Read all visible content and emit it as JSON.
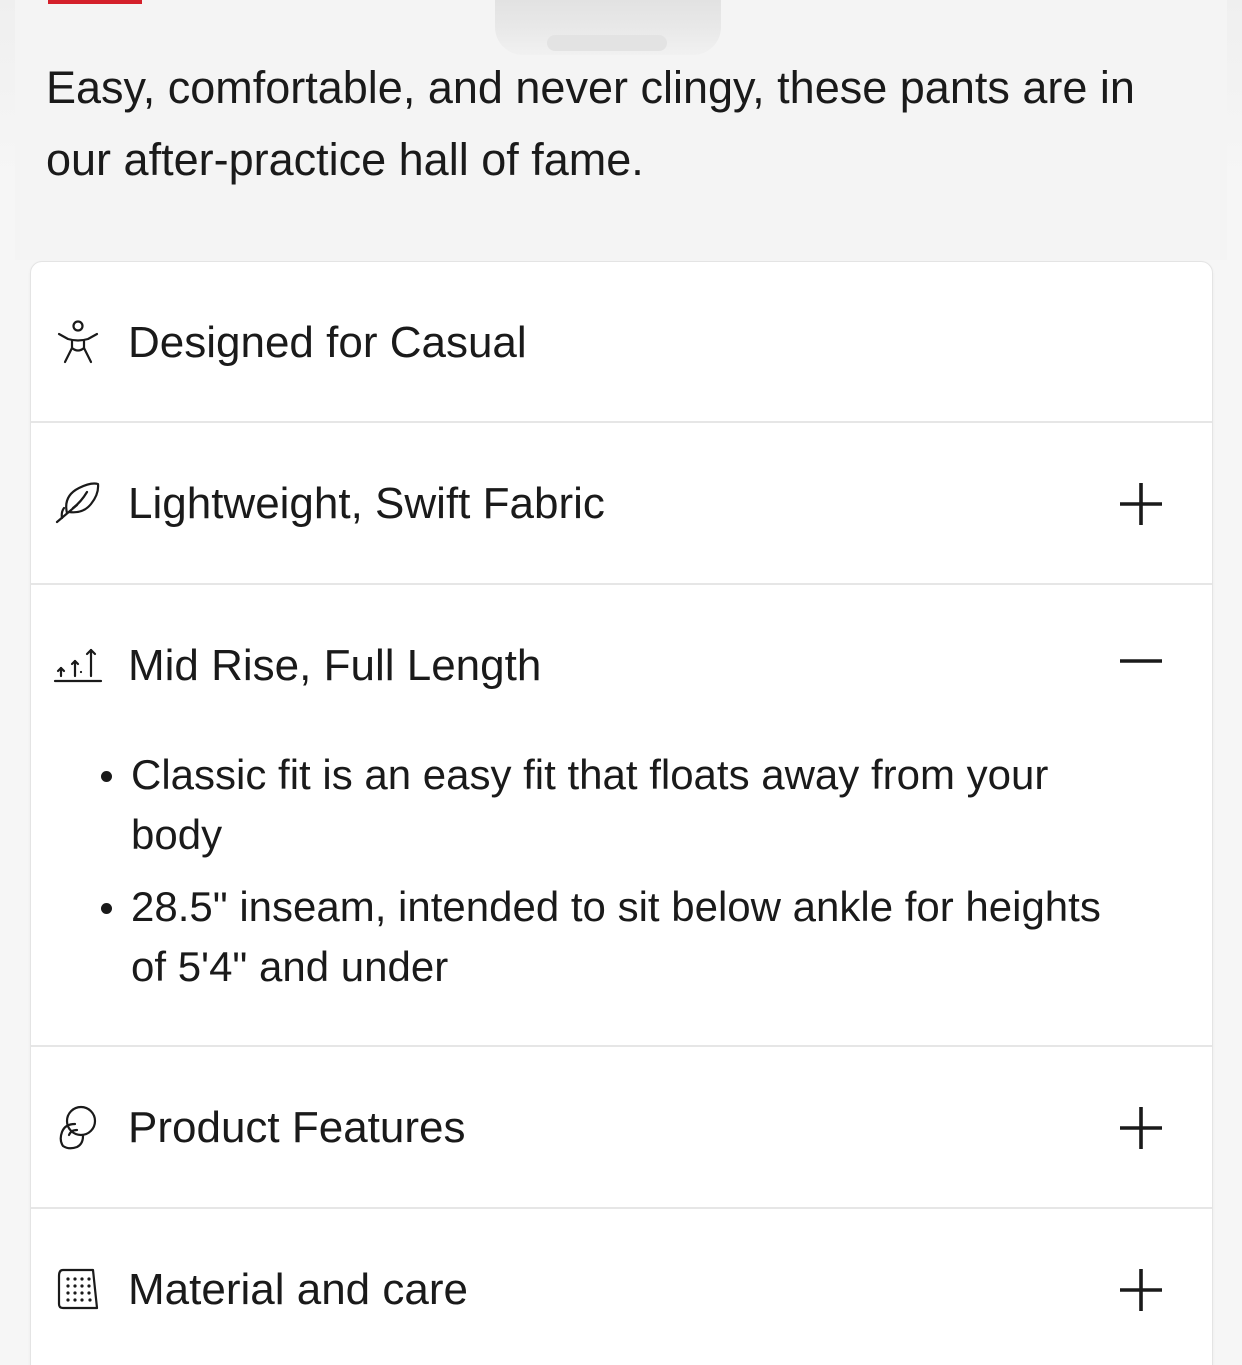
{
  "product": {
    "description": "Easy, comfortable, and never clingy, these pants are in our after-practice hall of fame."
  },
  "accent_color": "#d4202a",
  "details": {
    "rows": [
      {
        "label": "Designed for Casual",
        "icon": "person-icon",
        "expandable": false,
        "expanded": false
      },
      {
        "label": "Lightweight, Swift Fabric",
        "icon": "feather-icon",
        "expandable": true,
        "expanded": false
      },
      {
        "label": "Mid Rise, Full Length",
        "icon": "rise-arrows-icon",
        "expandable": true,
        "expanded": true,
        "bullets": [
          "Classic fit is an easy fit that floats away from your body",
          "28.5\" inseam, intended to sit below ankle for heights of 5'4\" and under"
        ]
      },
      {
        "label": "Product Features",
        "icon": "features-icon",
        "expandable": true,
        "expanded": false
      },
      {
        "label": "Material and care",
        "icon": "fabric-tag-icon",
        "expandable": true,
        "expanded": false
      }
    ]
  }
}
